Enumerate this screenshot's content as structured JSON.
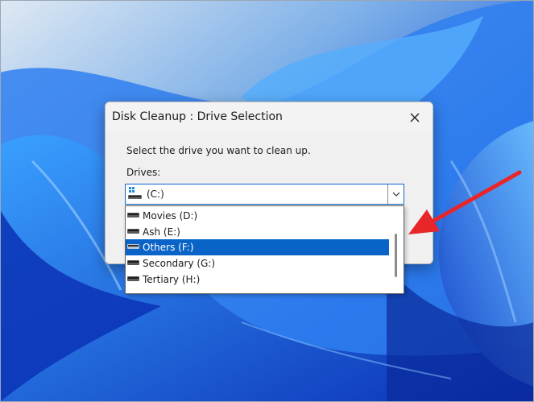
{
  "dialog": {
    "title": "Disk Cleanup : Drive Selection",
    "prompt": "Select the drive you want to clean up.",
    "drives_label": "Drives:",
    "selected_drive": "(C:)",
    "close_icon": "close-icon"
  },
  "drive_list": [
    {
      "label": "Movies (D:)",
      "selected": false
    },
    {
      "label": "Ash (E:)",
      "selected": false
    },
    {
      "label": "Others (F:)",
      "selected": true
    },
    {
      "label": "Secondary (G:)",
      "selected": false
    },
    {
      "label": "Tertiary (H:)",
      "selected": false
    }
  ],
  "colors": {
    "accent": "#0a64c8",
    "annotation_arrow": "#e8262a"
  }
}
